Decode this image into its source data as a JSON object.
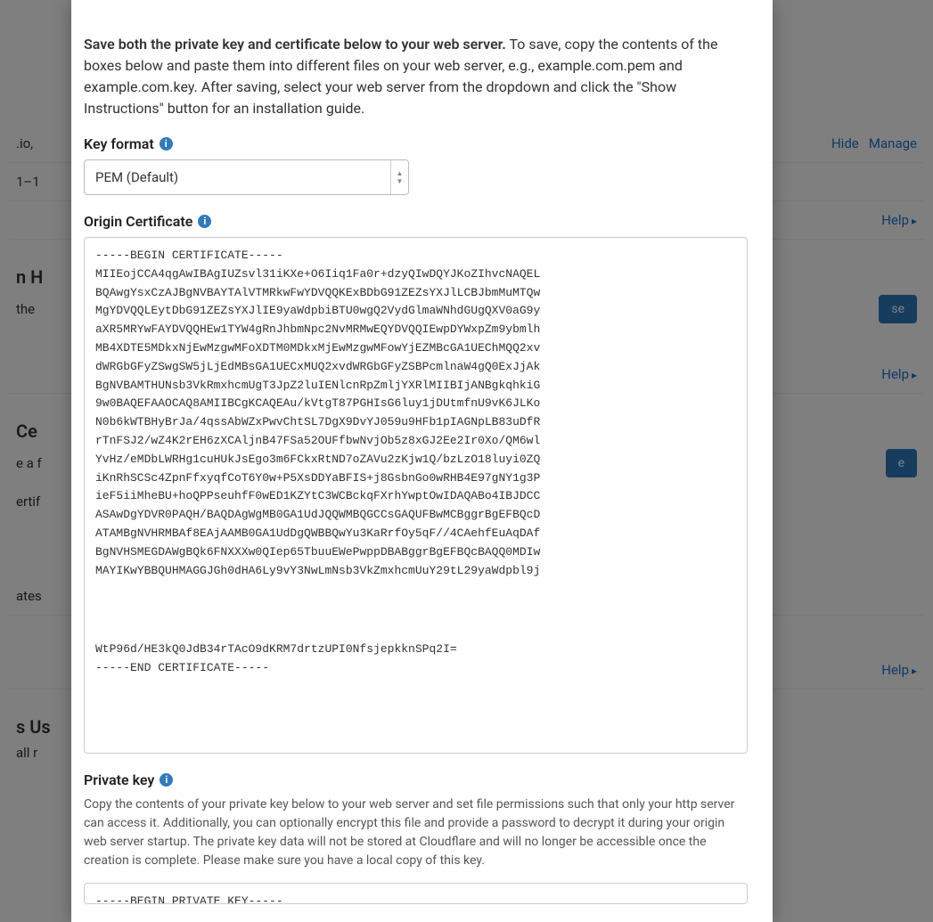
{
  "background": {
    "row1_left": ".io, ",
    "row1_links": [
      "Hide",
      "Manage"
    ],
    "row2_left": "1–1 ",
    "help": "Help",
    "section_hsts_title": "n H",
    "section_hsts_text": "the",
    "hsts_button": "se",
    "section_cert_title": "Ce",
    "section_cert_text1": "e a f",
    "section_cert_text2": "ertif",
    "cert_button": "e",
    "section_cert_row": "ates",
    "section_usage_title": "s Us",
    "section_usage_text": "all r"
  },
  "modal": {
    "intro_bold": "Save both the private key and certificate below to your web server.",
    "intro_rest": " To save, copy the contents of the boxes below and paste them into different files on your web server, e.g., example.com.pem and example.com.key. After saving, select your web server from the dropdown and click the \"Show Instructions\" button for an installation guide.",
    "key_format_label": "Key format",
    "key_format_value": "PEM (Default)",
    "origin_cert_label": "Origin Certificate",
    "cert_text_top": "-----BEGIN CERTIFICATE-----\nMIIEojCCA4qgAwIBAgIUZsvl31iKXe+O6Iiq1Fa0r+dzyQIwDQYJKoZIhvcNAQEL\nBQAwgYsxCzAJBgNVBAYTAlVTMRkwFwYDVQQKExBDbG91ZEZsYXJlLCBJbmMuMTQw\nMgYDVQQLEytDbG91ZEZsYXJlIE9yaWdpbiBTU0wgQ2VydGlmaWNhdGUgQXV0aG9y\naXR5MRYwFAYDVQQHEw1TYW4gRnJhbmNpc2NvMRMwEQYDVQQIEwpDYWxpZm9ybmlh\nMB4XDTE5MDkxNjEwMzgwMFoXDTM0MDkxMjEwMzgwMFowYjEZMBcGA1UEChMQQ2xv\ndWRGbGFyZSwgSW5jLjEdMBsGA1UECxMUQ2xvdWRGbGFyZSBPcmlnaW4gQ0ExJjAk\nBgNVBAMTHUNsb3VkRmxhcmUgT3JpZ2luIENlcnRpZmljYXRlMIIBIjANBgkqhkiG\n9w0BAQEFAAOCAQ8AMIIBCgKCAQEAu/kVtgT87PGHIsG6luy1jDUtmfnU9vK6JLKo\nN0b6kWTBHyBrJa/4qssAbWZxPwvChtSL7DgX9DvYJ059u9HFb1pIAGNpLB83uDfR\nrTnFSJ2/wZ4K2rEH6zXCAljnB47FSa52OUFfbwNvjOb5z8xGJ2Ee2Ir0Xo/QM6wl\nYvHz/eMDbLWRHg1cuHUkJsEgo3m6FCkxRtND7oZAVu2zKjw1Q/bzLzO18luyi0ZQ\niKnRhSCSc4ZpnFfxyqfCoT6Y0w+P5XsDDYaBFIS+j8GsbnGo0wRHB4E97gNY1g3P\nieF5iiMheBU+hoQPPseuhfF0wED1KZYtC3WCBckqFXrhYwptOwIDAQABo4IBJDCC\nASAwDgYDVR0PAQH/BAQDAgWgMB0GA1UdJQQWMBQGCCsGAQUFBwMCBggrBgEFBQcD\nATAMBgNVHRMBAf8EAjAAMB0GA1UdDgQWBBQwYu3KaRrfOy5qF//4CAehfEuAqDAf\nBgNVHSMEGDAWgBQk6FNXXXw0QIep65TbuuEWePwppDBABggrBgEFBQcBAQQ0MDIw\nMAYIKwYBBQUHMAGGJGh0dHA6Ly9vY3NwLmNsb3VkZmxhcmUuY29tL29yaWdpbl9j",
    "cert_text_gap": ".",
    "cert_text_bottom": "WtP96d/HE3kQ0JdB34rTAcO9dKRM7drtzUPI0NfsjepkknSPq2I=\n-----END CERTIFICATE-----",
    "private_key_label": "Private key",
    "private_key_desc": "Copy the contents of your private key below to your web server and set file permissions such that only your http server can access it. Additionally, you can optionally encrypt this file and provide a password to decrypt it during your origin web server startup. The private key data will not be stored at Cloudflare and will no longer be accessible once the creation is complete. Please make sure you have a local copy of this key.",
    "private_key_text": "-----BEGIN PRIVATE KEY-----"
  }
}
